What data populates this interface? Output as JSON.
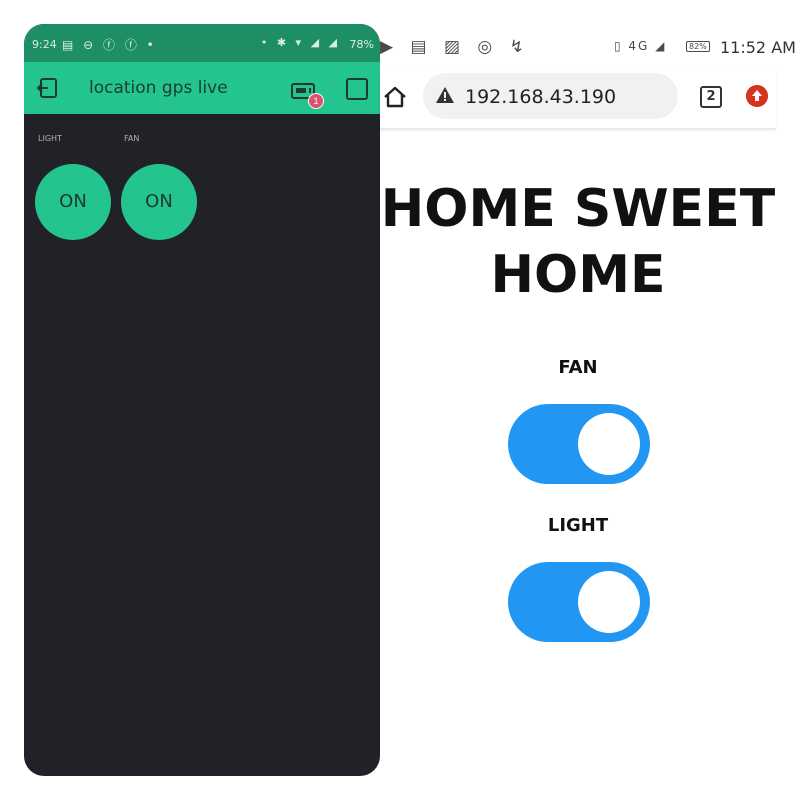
{
  "blynk": {
    "status_bar": {
      "time": "9:24",
      "left_icons": "▤ ⊖ ⓕ ⓕ •",
      "right_icons": "• ✱ ▾ ◢ ◢",
      "battery": "78%"
    },
    "app_title": "location gps live",
    "notification_count": "1",
    "widgets": [
      {
        "label": "LIGHT",
        "button": "ON"
      },
      {
        "label": "FAN",
        "button": "ON"
      }
    ],
    "colors": {
      "accent": "#23c48e",
      "background": "#212227",
      "status": "#1e8f64"
    }
  },
  "browser": {
    "status_bar": {
      "left_icons": "▶ ▤ ▨ ◎ ↯",
      "right_icons": "▯ 4G ◢",
      "battery": "82%",
      "time": "11:52 AM"
    },
    "url": "192.168.43.190",
    "tab_count": "2",
    "colors": {
      "toggle": "#2196f3",
      "update": "#d6331f"
    }
  },
  "page": {
    "title": "HOME SWEET HOME",
    "switches": [
      {
        "label": "FAN",
        "state": "on"
      },
      {
        "label": "LIGHT",
        "state": "on"
      }
    ]
  }
}
